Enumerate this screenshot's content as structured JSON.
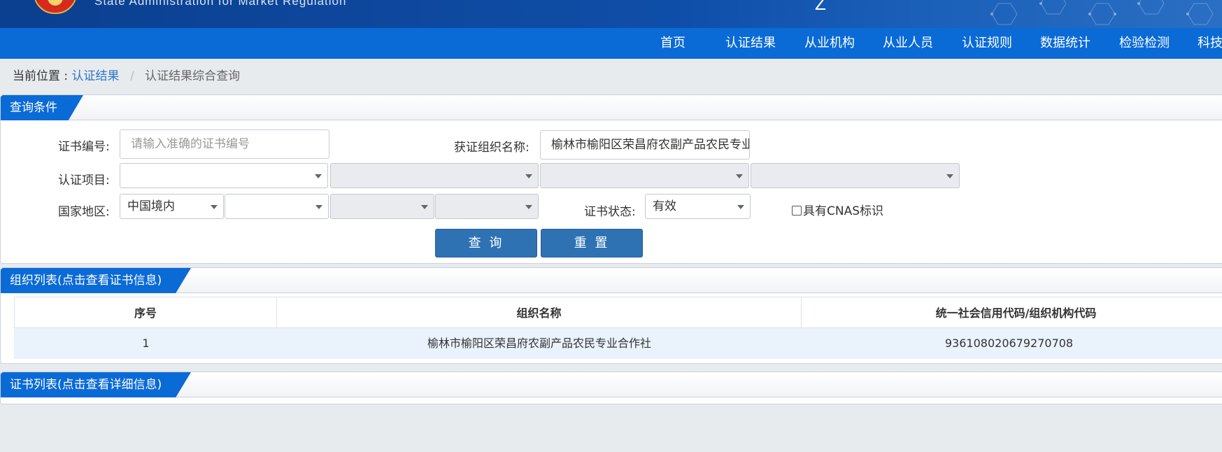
{
  "header": {
    "agency_en": "State Administration  for  Market Regulation",
    "glyph": "Z"
  },
  "nav": {
    "items": [
      "首页",
      "认证结果",
      "从业机构",
      "从业人员",
      "认证规则",
      "数据统计",
      "检验检测",
      "科技"
    ]
  },
  "breadcrumb": {
    "prefix": "当前位置 :",
    "link": "认证结果",
    "separator": "/",
    "current": "认证结果综合查询"
  },
  "query_panel": {
    "title": "查询条件",
    "cert_no_label": "证书编号:",
    "cert_no_placeholder": "请输入准确的证书编号",
    "org_name_label": "获证组织名称:",
    "org_name_value": "榆林市榆阳区荣昌府农副产品农民专业合作社",
    "project_label": "认证项目:",
    "project_selects": [
      "",
      "",
      "",
      ""
    ],
    "region_label": "国家地区:",
    "region_selects": [
      "中国境内",
      "",
      "",
      ""
    ],
    "status_label": "证书状态:",
    "status_value": "有效",
    "cnas_label": "具有CNAS标识",
    "cnas_checked": false,
    "search_button": "查 询",
    "reset_button": "重 置"
  },
  "org_panel": {
    "title": "组织列表(点击查看证书信息)",
    "columns": [
      "序号",
      "组织名称",
      "统一社会信用代码/组织机构代码"
    ],
    "rows": [
      [
        "1",
        "榆林市榆阳区荣昌府农副产品农民专业合作社",
        "93610802067927070​8"
      ]
    ]
  },
  "cert_panel": {
    "title": "证书列表(点击查看详细信息)"
  },
  "colors": {
    "nav_bg": "#0a6ad6",
    "banner_bg": "#0f4ea8",
    "button_bg": "#2f72b4",
    "row_highlight": "#eaf2fc"
  }
}
